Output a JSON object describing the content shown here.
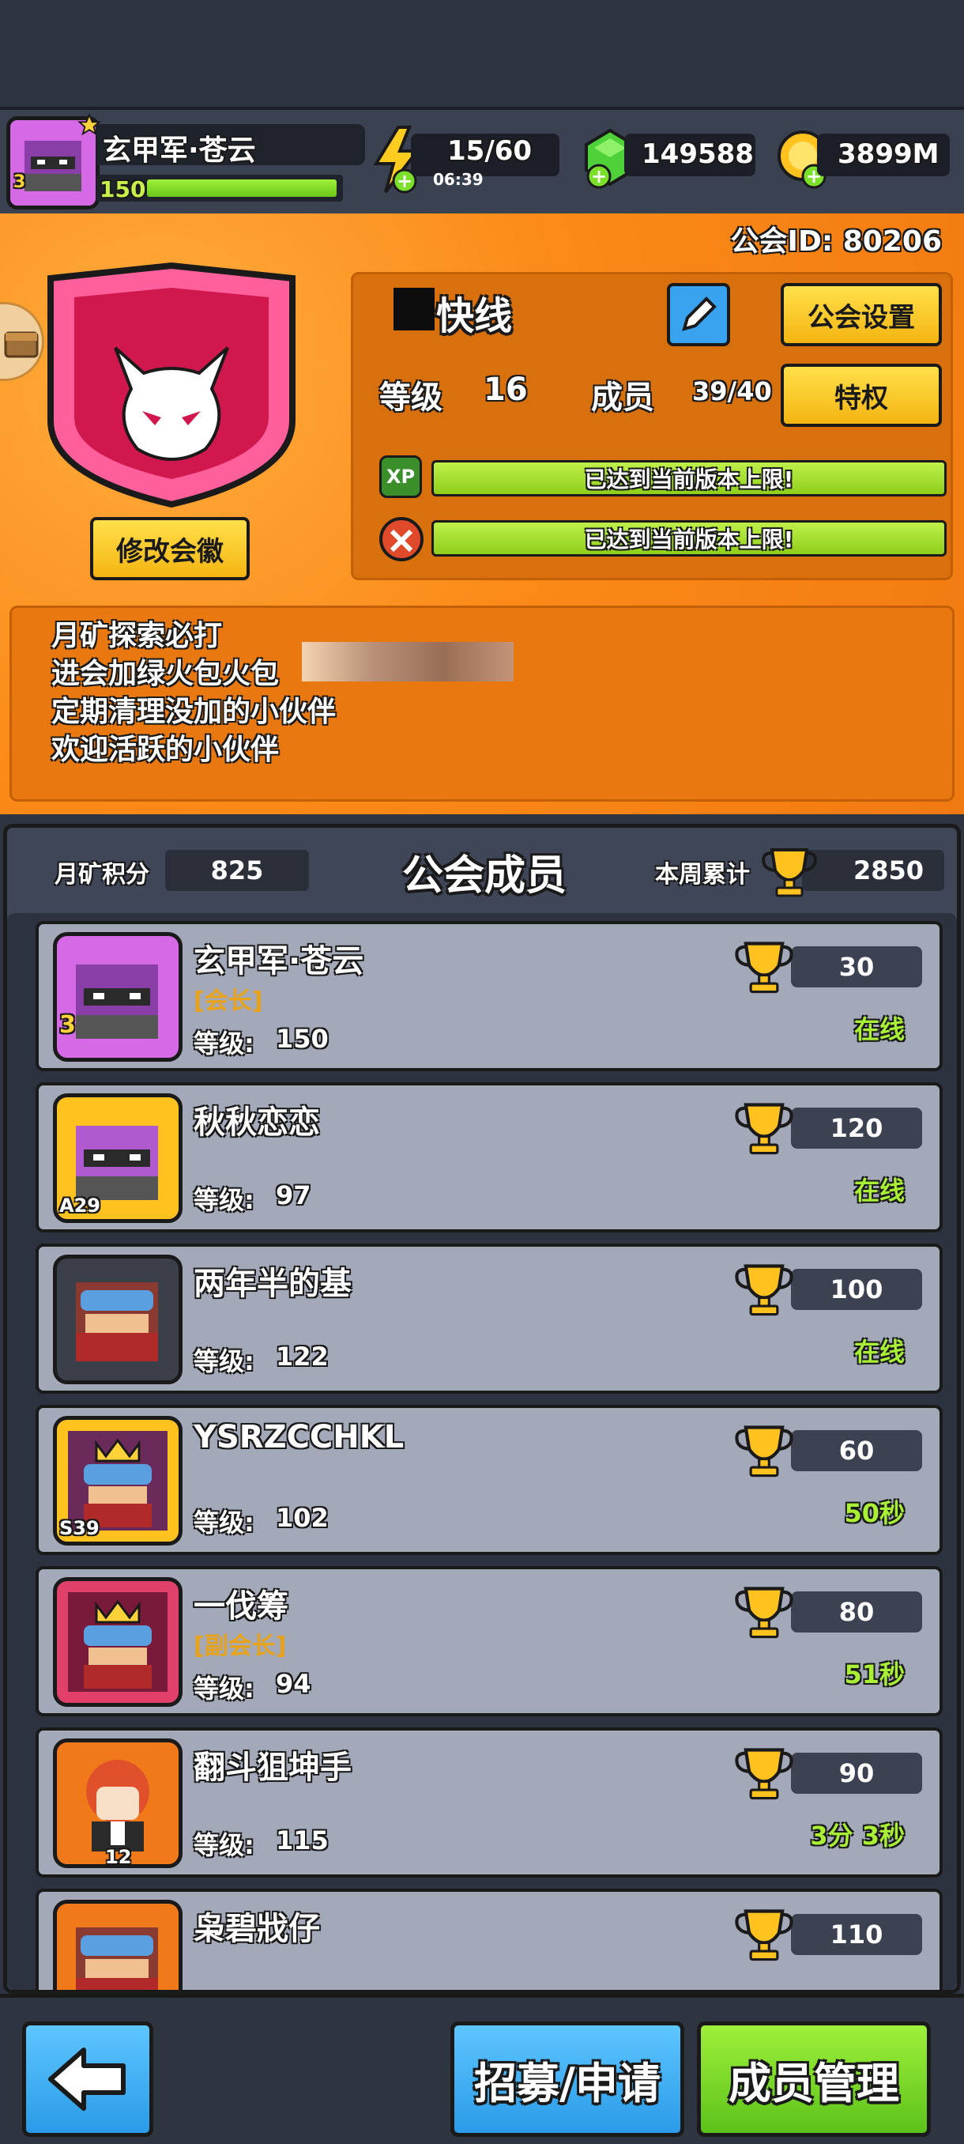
{
  "player": {
    "name": "玄甲军·苍云",
    "level": "150",
    "avatar_badge": "3"
  },
  "resources": {
    "energy": "15/60",
    "energy_timer": "06:39",
    "gems": "149588",
    "coins": "3899M"
  },
  "guild": {
    "id_label": "公会ID: 80206",
    "name": "快线",
    "settings_button": "公会设置",
    "level_label": "等级",
    "level_value": "16",
    "members_label": "成员",
    "members_value": "39/40",
    "privilege_button": "特权",
    "xp_badge": "XP",
    "xp_bar_text": "已达到当前版本上限!",
    "skill_bar_text": "已达到当前版本上限!",
    "change_emblem_button": "修改会徽",
    "announcement": [
      "月矿探索必打",
      "进会加绿火包火包",
      "定期清理没加的小伙伴",
      "欢迎活跃的小伙伴"
    ]
  },
  "members_panel": {
    "moon_points_label": "月矿积分",
    "moon_points_value": "825",
    "title": "公会成员",
    "weekly_total_label": "本周累计",
    "weekly_total_value": "2850",
    "level_prefix": "等级:",
    "members": [
      {
        "name": "玄甲军·苍云",
        "role": "[会长]",
        "level": "150",
        "trophies": "30",
        "status": "在线",
        "badge": "3"
      },
      {
        "name": "秋秋恋恋",
        "role": "",
        "level": "97",
        "trophies": "120",
        "status": "在线",
        "badge": "A29"
      },
      {
        "name": "两年半的基",
        "role": "",
        "level": "122",
        "trophies": "100",
        "status": "在线",
        "badge": ""
      },
      {
        "name": "YSRZCCHKL",
        "role": "",
        "level": "102",
        "trophies": "60",
        "status": "50秒",
        "badge": "S39"
      },
      {
        "name": "一伐筹",
        "role": "[副会长]",
        "level": "94",
        "trophies": "80",
        "status": "51秒",
        "badge": ""
      },
      {
        "name": "翻斗狙坤手",
        "role": "",
        "level": "115",
        "trophies": "90",
        "status": "3分 3秒",
        "badge": "12"
      },
      {
        "name": "枭碧戕仔",
        "role": "",
        "level": "",
        "trophies": "110",
        "status": "",
        "badge": ""
      }
    ]
  },
  "bottom": {
    "back_icon": "arrow-left-icon",
    "recruit_button": "招募/申请",
    "manage_button": "成员管理"
  },
  "colors": {
    "orange": "#f7851a",
    "green_online": "#a9ef36",
    "gold": "#e8a21a",
    "panel": "#3f4658",
    "card": "#a3a9b9"
  }
}
